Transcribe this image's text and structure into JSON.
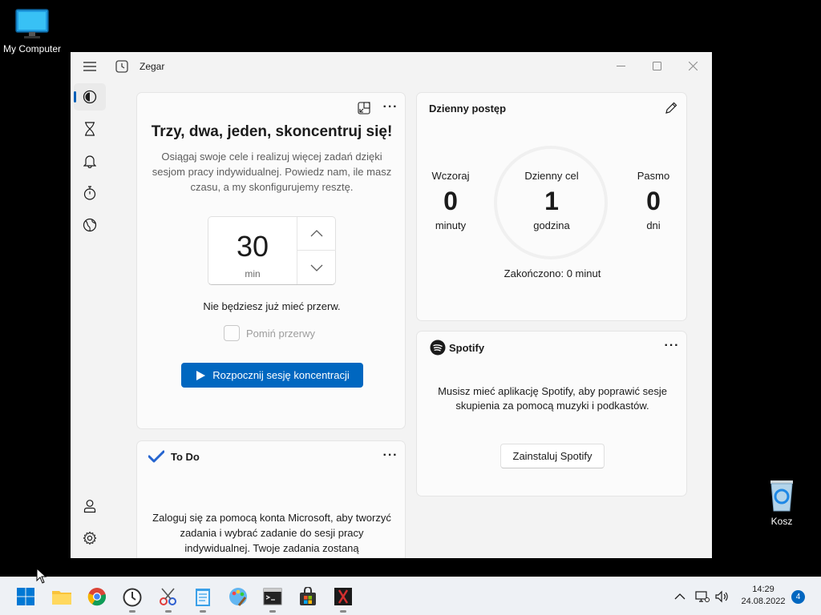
{
  "desktop": {
    "my_computer_label": "My Computer",
    "recycle_bin_label": "Kosz"
  },
  "window": {
    "title": "Zegar"
  },
  "nav": {
    "items": [
      {
        "id": "focus",
        "icon": "focus-session-icon",
        "active": true
      },
      {
        "id": "timer",
        "icon": "hourglass-icon"
      },
      {
        "id": "alarm",
        "icon": "bell-icon"
      },
      {
        "id": "stopwatch",
        "icon": "stopwatch-icon"
      },
      {
        "id": "world-clock",
        "icon": "globe-icon"
      },
      {
        "id": "account",
        "icon": "person-icon"
      },
      {
        "id": "settings",
        "icon": "gear-icon"
      }
    ]
  },
  "focus": {
    "title": "Trzy, dwa, jeden, skoncentruj się!",
    "description": "Osiągaj swoje cele i realizuj więcej zadań dzięki sesjom pracy indywidualnej. Powiedz nam, ile masz czasu, a my skonfigurujemy resztę.",
    "minutes": "30",
    "unit": "min",
    "no_breaks": "Nie będziesz już mieć przerw.",
    "skip_breaks_label": "Pomiń przerwy",
    "start_label": "Rozpocznij sesję koncentracji"
  },
  "todo": {
    "title": "To Do",
    "text": "Zaloguj się za pomocą konta Microsoft, aby tworzyć zadania i wybrać zadanie do sesji pracy indywidualnej. Twoje zadania zostaną"
  },
  "progress": {
    "title": "Dzienny postęp",
    "yesterday": {
      "label": "Wczoraj",
      "value": "0",
      "unit": "minuty"
    },
    "goal": {
      "label": "Dzienny cel",
      "value": "1",
      "unit": "godzina"
    },
    "streak": {
      "label": "Pasmo",
      "value": "0",
      "unit": "dni"
    },
    "completed": "Zakończono: 0 minut"
  },
  "spotify": {
    "brand": "Spotify",
    "text": "Musisz mieć aplikację Spotify, aby poprawić sesje skupienia za pomocą muzyki i podkastów.",
    "install_label": "Zainstaluj Spotify"
  },
  "taskbar": {
    "time": "14:29",
    "date": "24.08.2022",
    "notifications": "4"
  },
  "colors": {
    "accent": "#0067c0",
    "spotify": "#1b1b1b"
  }
}
